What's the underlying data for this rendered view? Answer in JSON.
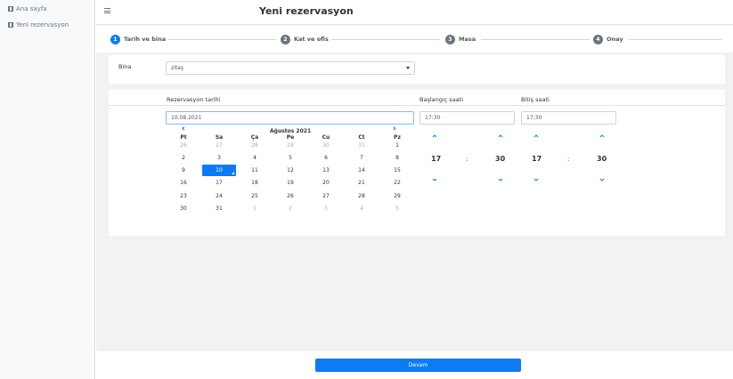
{
  "sidebar": {
    "items": [
      {
        "label": "Ana sayfa",
        "icon": "building-icon"
      },
      {
        "label": "Yeni rezervasyon",
        "icon": "building-icon"
      }
    ]
  },
  "header": {
    "title": "Yeni rezervasyon"
  },
  "steps": [
    {
      "num": "1",
      "label": "Tarih ve bina",
      "active": true
    },
    {
      "num": "2",
      "label": "Kat ve ofis",
      "active": false
    },
    {
      "num": "3",
      "label": "Masa",
      "active": false
    },
    {
      "num": "4",
      "label": "Onay",
      "active": false
    }
  ],
  "building": {
    "label": "Bina",
    "value": "zitaş"
  },
  "date": {
    "label": "Rezervasyon tarihi",
    "value": "10.08.2021"
  },
  "start_time": {
    "label": "Başlangıç saati",
    "value": "17:30",
    "hour": "17",
    "minute": "30"
  },
  "end_time": {
    "label": "Bitiş saati",
    "value": "17:30",
    "hour": "17",
    "minute": "30"
  },
  "time_separator": ":",
  "calendar": {
    "prev": "‹",
    "next": "›",
    "month": "Ağustos 2021",
    "weekdays": [
      "Pt",
      "Sa",
      "Ça",
      "Pe",
      "Cu",
      "Ct",
      "Pz"
    ],
    "weeks": [
      [
        "26",
        "27",
        "28",
        "29",
        "30",
        "31",
        "1"
      ],
      [
        "2",
        "3",
        "4",
        "5",
        "6",
        "7",
        "8"
      ],
      [
        "9",
        "10",
        "11",
        "12",
        "13",
        "14",
        "15"
      ],
      [
        "16",
        "17",
        "18",
        "19",
        "20",
        "21",
        "22"
      ],
      [
        "23",
        "24",
        "25",
        "26",
        "27",
        "28",
        "29"
      ],
      [
        "30",
        "31",
        "1",
        "2",
        "3",
        "4",
        "5"
      ]
    ],
    "selected": "10"
  },
  "footer": {
    "continue_label": "Devam"
  },
  "colors": {
    "accent": "#0d7cf2",
    "inactive_step": "#6c757d"
  }
}
